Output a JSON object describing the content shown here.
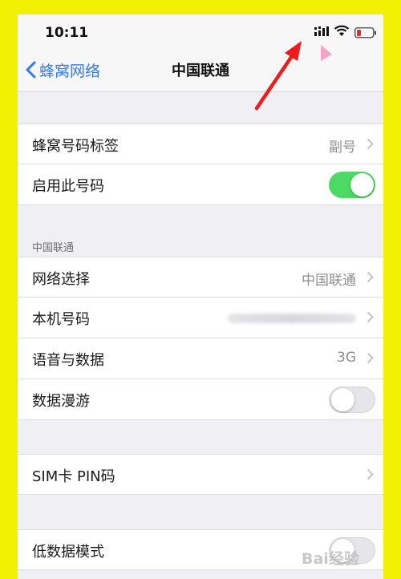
{
  "status": {
    "time": "10:11"
  },
  "nav": {
    "back_label": "蜂窝网络",
    "title": "中国联通"
  },
  "rows": {
    "label_tag": {
      "label": "蜂窝号码标签",
      "value": "副号"
    },
    "enable_line": {
      "label": "启用此号码",
      "toggle_on": true
    },
    "network_select": {
      "label": "网络选择",
      "value": "中国联通"
    },
    "my_number": {
      "label": "本机号码"
    },
    "voice_data": {
      "label": "语音与数据",
      "value": "3G"
    },
    "data_roaming": {
      "label": "数据漫游",
      "toggle_on": false
    },
    "sim_pin": {
      "label": "SIM卡 PIN码"
    },
    "low_data": {
      "label": "低数据模式"
    }
  },
  "section": {
    "carrier_header": "中国联通"
  },
  "watermark": {
    "text": "Bai经验"
  },
  "colors": {
    "accent": "#2f7bf5",
    "toggle_on": "#4cd964",
    "border_outer": "#6ee61e",
    "border_inner": "#f2f005",
    "arrow": "#ee1c1c"
  }
}
